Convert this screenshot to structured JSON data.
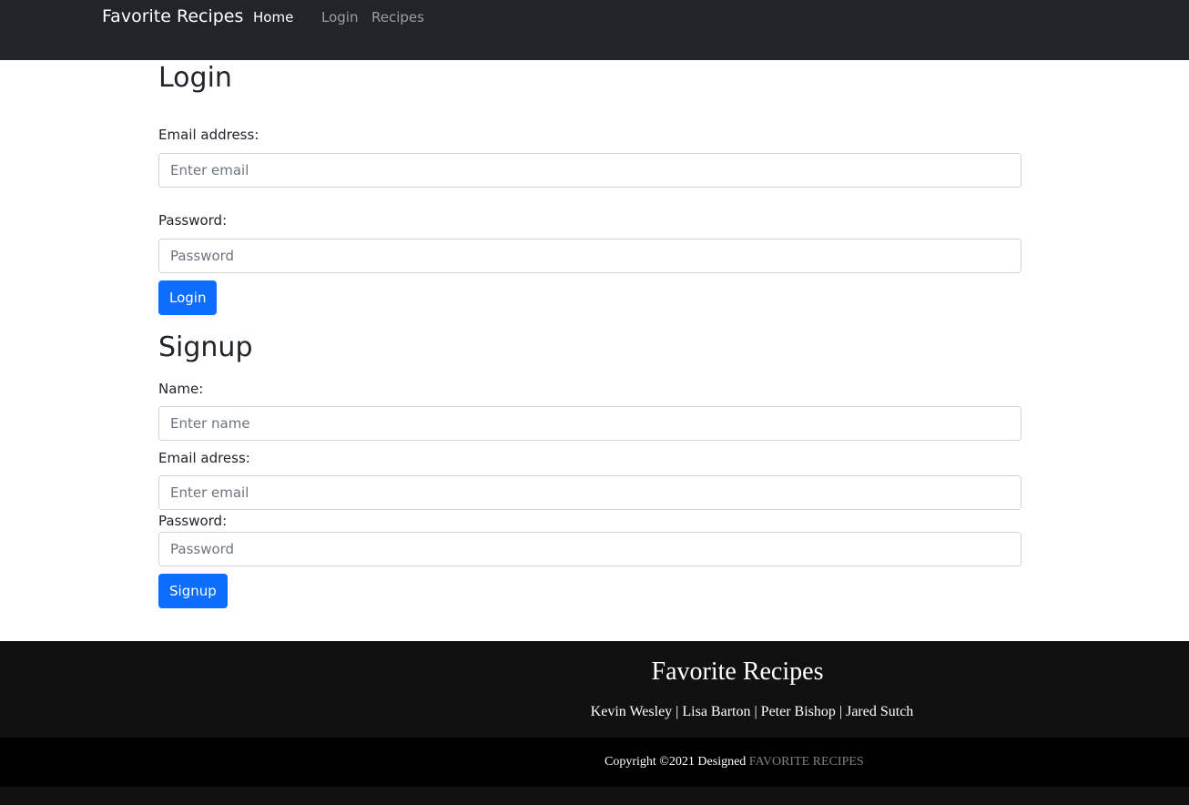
{
  "navbar": {
    "brand": "Favorite Recipes",
    "links": [
      {
        "label": "Home"
      },
      {
        "label": "Login"
      },
      {
        "label": "Recipes"
      }
    ]
  },
  "login": {
    "title": "Login",
    "email_label": "Email address:",
    "email_placeholder": "Enter email",
    "password_label": "Password:",
    "password_placeholder": "Password",
    "button": "Login"
  },
  "signup": {
    "title": "Signup",
    "name_label": "Name:",
    "name_placeholder": "Enter name",
    "email_label": "Email adress:",
    "email_placeholder": "Enter email",
    "password_label": "Password:",
    "password_placeholder": "Password",
    "button": "Signup"
  },
  "footer": {
    "title": "Favorite Recipes",
    "names": "Kevin Wesley | Lisa Barton | Peter Bishop | Jared Sutch",
    "copyright_prefix": "Copyright ©2021 Designed",
    "copyright_brand": "FAVORITE RECIPES"
  },
  "colors": {
    "navbar_bg": "#212529",
    "primary_button": "#0d6efd",
    "footer_bg": "#111111",
    "copyright_bg": "#000000"
  }
}
